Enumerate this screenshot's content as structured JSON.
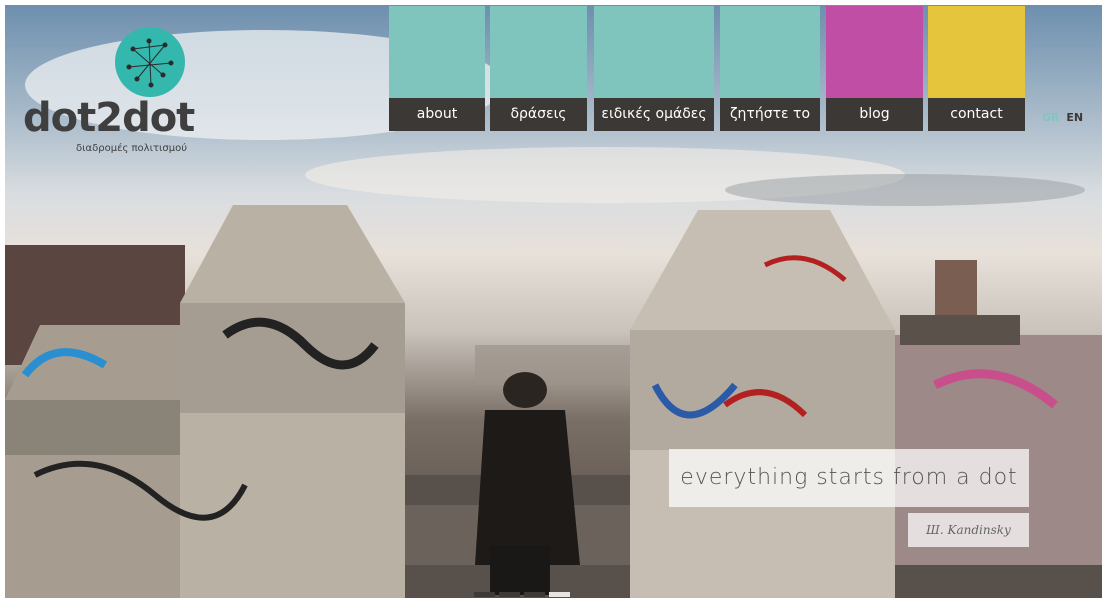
{
  "logo": {
    "wordmark": "dot2dot",
    "tagline": "διαδρομές πολιτισμού",
    "accent_color": "#34b7ad"
  },
  "nav": {
    "items": [
      {
        "label": "about",
        "color": "#7fc4bd"
      },
      {
        "label": "δράσεις",
        "color": "#7fc4bd"
      },
      {
        "label": "ειδικές ομάδες",
        "color": "#7fc4bd"
      },
      {
        "label": "ζητήστε το",
        "color": "#7fc4bd"
      },
      {
        "label": "blog",
        "color": "#c04ea4"
      },
      {
        "label": "contact",
        "color": "#e4c53b"
      }
    ],
    "label_bar_color": "#3b3836"
  },
  "language": {
    "gr": "GR",
    "en": "EN",
    "active": "GR"
  },
  "hero": {
    "quote": "everything starts from a dot",
    "author": "Ш. Kandinsky",
    "slides_count": 4,
    "active_slide": 4
  }
}
